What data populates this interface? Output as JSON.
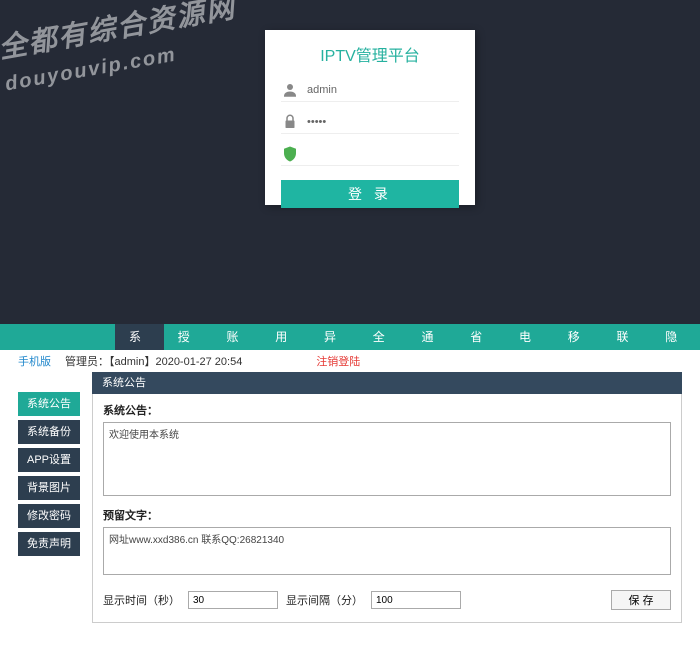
{
  "watermark": {
    "line1": "全都有综合资源网",
    "line2": "douyouvip.com"
  },
  "login": {
    "title": "IPTV管理平台",
    "username": "admin",
    "password": "•••••",
    "captcha": "",
    "button": "登 录"
  },
  "nav": {
    "items": [
      "系统",
      "授权",
      "账号",
      "用户",
      "异常",
      "全网",
      "通用",
      "省内",
      "电信",
      "移动",
      "联通",
      "隐藏"
    ],
    "active_index": 0
  },
  "info": {
    "mobile_link": "手机版",
    "admin_label": "管理员：【admin】2020-01-27 20:54",
    "logout": "注销登陆"
  },
  "sidebar": {
    "items": [
      "系统公告",
      "系统备份",
      "APP设置",
      "背景图片",
      "修改密码",
      "免责声明"
    ],
    "active_index": 0
  },
  "panel": {
    "header": "系统公告",
    "f1_label": "系统公告：",
    "f1_value": "欢迎使用本系统",
    "f2_label": "预留文字：",
    "f2_value": "网址www.xxd386.cn 联系QQ:26821340",
    "time_label": "显示时间（秒）",
    "time_value": "30",
    "interval_label": "显示间隔（分）",
    "interval_value": "100",
    "save": "保 存"
  }
}
